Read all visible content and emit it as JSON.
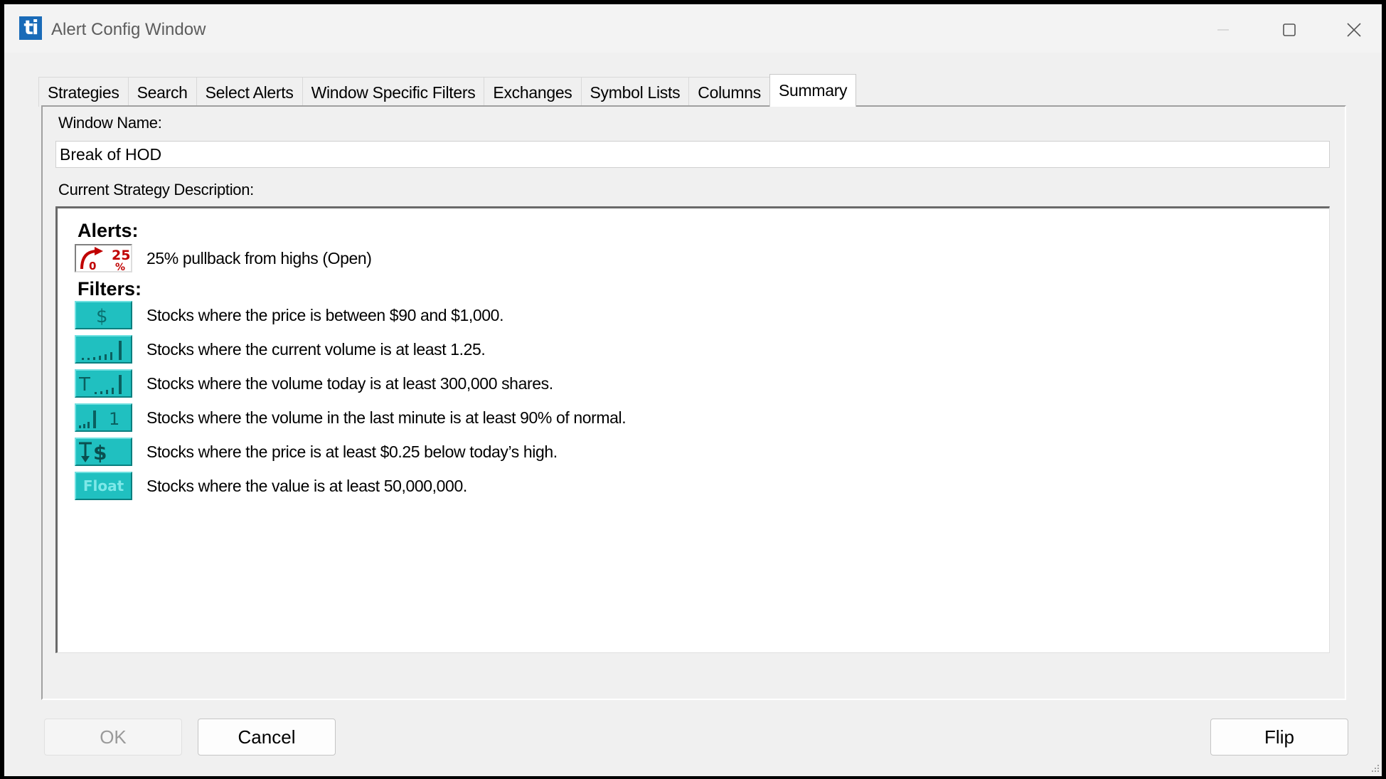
{
  "window": {
    "title": "Alert Config Window",
    "logo_text": "ti"
  },
  "tabs": [
    {
      "label": "Strategies",
      "active": false
    },
    {
      "label": "Search",
      "active": false
    },
    {
      "label": "Select Alerts",
      "active": false
    },
    {
      "label": "Window Specific Filters",
      "active": false
    },
    {
      "label": "Exchanges",
      "active": false
    },
    {
      "label": "Symbol Lists",
      "active": false
    },
    {
      "label": "Columns",
      "active": false
    },
    {
      "label": "Summary",
      "active": true
    }
  ],
  "summary": {
    "window_name_label": "Window Name:",
    "window_name_value": "Break of HOD",
    "description_label": "Current Strategy Description:",
    "alerts_title": "Alerts:",
    "alerts": [
      {
        "icon": "pullback-from-highs-icon",
        "icon_text_top": "25",
        "icon_text_bottom": "%",
        "icon_text_small": "0",
        "text": "25% pullback from highs (Open)"
      }
    ],
    "filters_title": "Filters:",
    "filters": [
      {
        "icon": "price-dollar-icon",
        "icon_text": "$",
        "text": "Stocks where the price is between $90 and $1,000."
      },
      {
        "icon": "current-volume-icon",
        "icon_text": "",
        "text": "Stocks where the current volume is at least 1.25."
      },
      {
        "icon": "volume-today-icon",
        "icon_text": "T",
        "text": "Stocks where the volume today is at least 300,000 shares."
      },
      {
        "icon": "volume-last-minute-icon",
        "icon_text": "1",
        "text": "Stocks where the volume in the last minute is at least 90% of normal."
      },
      {
        "icon": "below-high-dollar-icon",
        "icon_text": "$",
        "text": "Stocks where the price is at least $0.25 below today’s high."
      },
      {
        "icon": "float-icon",
        "icon_text": "Float",
        "text": "Stocks where the value is at least 50,000,000."
      }
    ]
  },
  "buttons": {
    "ok": "OK",
    "cancel": "Cancel",
    "flip": "Flip"
  },
  "colors": {
    "filter_icon_teal": "#20c0c0",
    "alert_icon_red": "#c00000",
    "logo_blue": "#1a6bb8"
  }
}
